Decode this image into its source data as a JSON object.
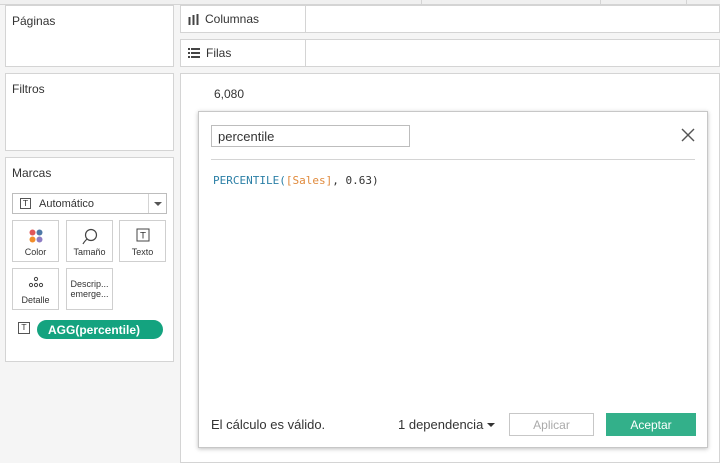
{
  "panels": {
    "pages_title": "Páginas",
    "filters_title": "Filtros",
    "marks_title": "Marcas"
  },
  "shelves": {
    "columns_label": "Columnas",
    "rows_label": "Filas"
  },
  "marks": {
    "type_dropdown": "Automático",
    "buttons": {
      "color": "Color",
      "size": "Tamaño",
      "text": "Texto",
      "detail": "Detalle",
      "tooltip_line1": "Descrip...",
      "tooltip_line2": "emerge..."
    },
    "pill": "AGG(percentile)"
  },
  "canvas": {
    "value": "6,080"
  },
  "calc_dialog": {
    "name_value": "percentile",
    "formula": {
      "fn": "PERCENTILE(",
      "field": "[Sales]",
      "rest": ", 0.63)"
    },
    "status": "El cálculo es válido.",
    "dependencies": "1 dependencia",
    "apply_label": "Aplicar",
    "ok_label": "Aceptar"
  },
  "colors": {
    "pill": "#14a37f",
    "accept_button": "#33b08a",
    "formula_function": "#2b7fa6",
    "formula_field": "#e08a3c"
  },
  "icons": {
    "columns": "columns-icon",
    "rows": "rows-icon",
    "color": "color-dots-icon",
    "size": "size-lasso-icon",
    "text": "text-box-icon",
    "detail": "detail-dots-icon",
    "close": "close-icon"
  }
}
